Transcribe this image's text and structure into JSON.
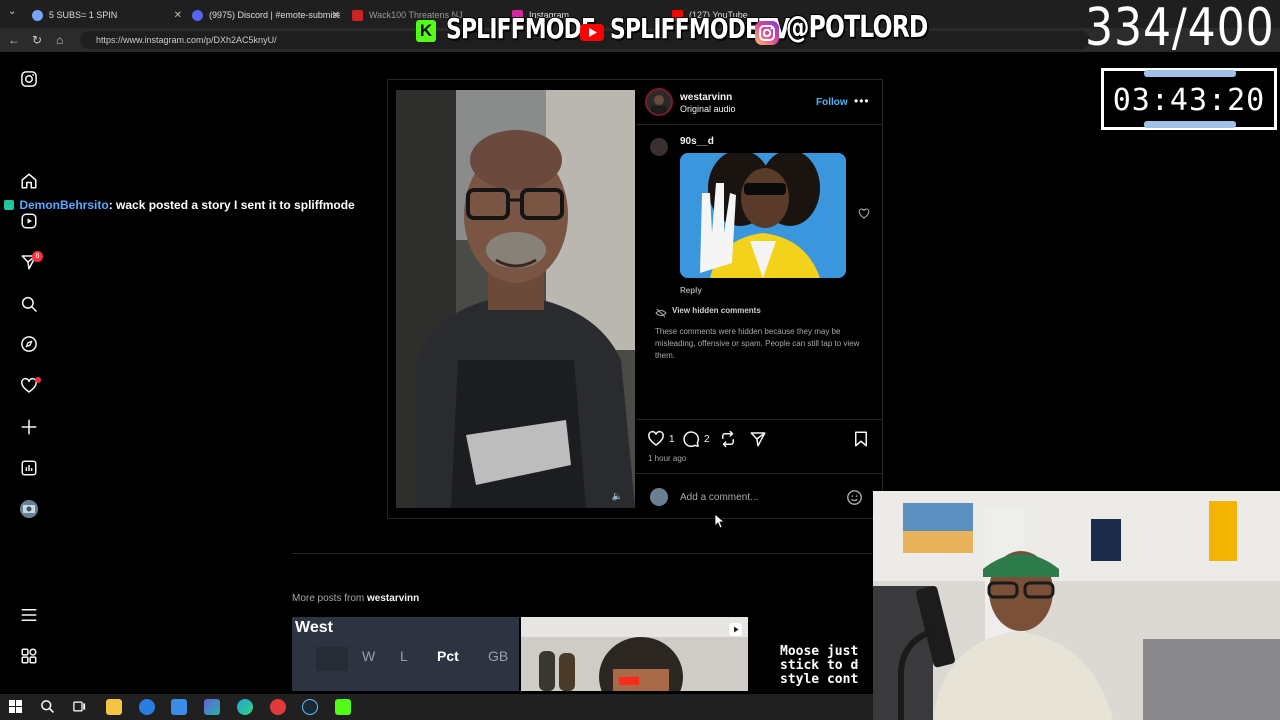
{
  "browser": {
    "tabs": [
      {
        "label": "5 SUBS= 1 SPIN",
        "color": "#7aa2ff"
      },
      {
        "label": "(9975) Discord | #emote-submissi",
        "color": "#5865f2"
      },
      {
        "label": "Wack100 Threatens NJ",
        "color": "#cc2222"
      },
      {
        "label": "Instagram",
        "color": "#d6249f"
      },
      {
        "label": "(127) YouTube",
        "color": "#ff0000"
      }
    ],
    "url": "https://www.instagram.com/p/DXh2AC5knyU/"
  },
  "overlay": {
    "kick_handle": "SPLIFFMODE",
    "youtube_handle": "SPLIFFMODETV",
    "instagram_handle": "@POTLORD",
    "counter": "334/400",
    "timer": "03:43:20",
    "colors": {
      "kick": "#53fc18",
      "youtube": "#ff0000"
    }
  },
  "chat": {
    "user": "DemonBehrsito",
    "message": ": wack posted a story I sent it to spliffmode"
  },
  "rail": {
    "icons": [
      "instagram-logo-icon",
      "home-icon",
      "reels-icon",
      "messages-icon",
      "search-icon",
      "explore-icon",
      "heart-icon",
      "create-icon",
      "dashboard-icon",
      "profile-avatar",
      "menu-icon",
      "also-from-meta-icon"
    ],
    "messages_badge": "6"
  },
  "post": {
    "username": "westarvinn",
    "audio": "Original audio",
    "follow_label": "Follow",
    "comment": {
      "user": "90s__d",
      "reply_label": "Reply"
    },
    "view_hidden_label": "View hidden comments",
    "hidden_note": "These comments were hidden because they may be misleading, offensive or spam. People can still tap to view them.",
    "likes": "1",
    "comments": "2",
    "time_ago": "1 hour ago",
    "comment_placeholder": "Add a comment..."
  },
  "more_posts": {
    "prefix": "More posts from ",
    "user": "westarvinn",
    "standings": {
      "title": "West",
      "cols": [
        "W",
        "L",
        "Pct",
        "GB"
      ]
    },
    "text_post": "Moose just\nstick to d\nstyle cont"
  }
}
